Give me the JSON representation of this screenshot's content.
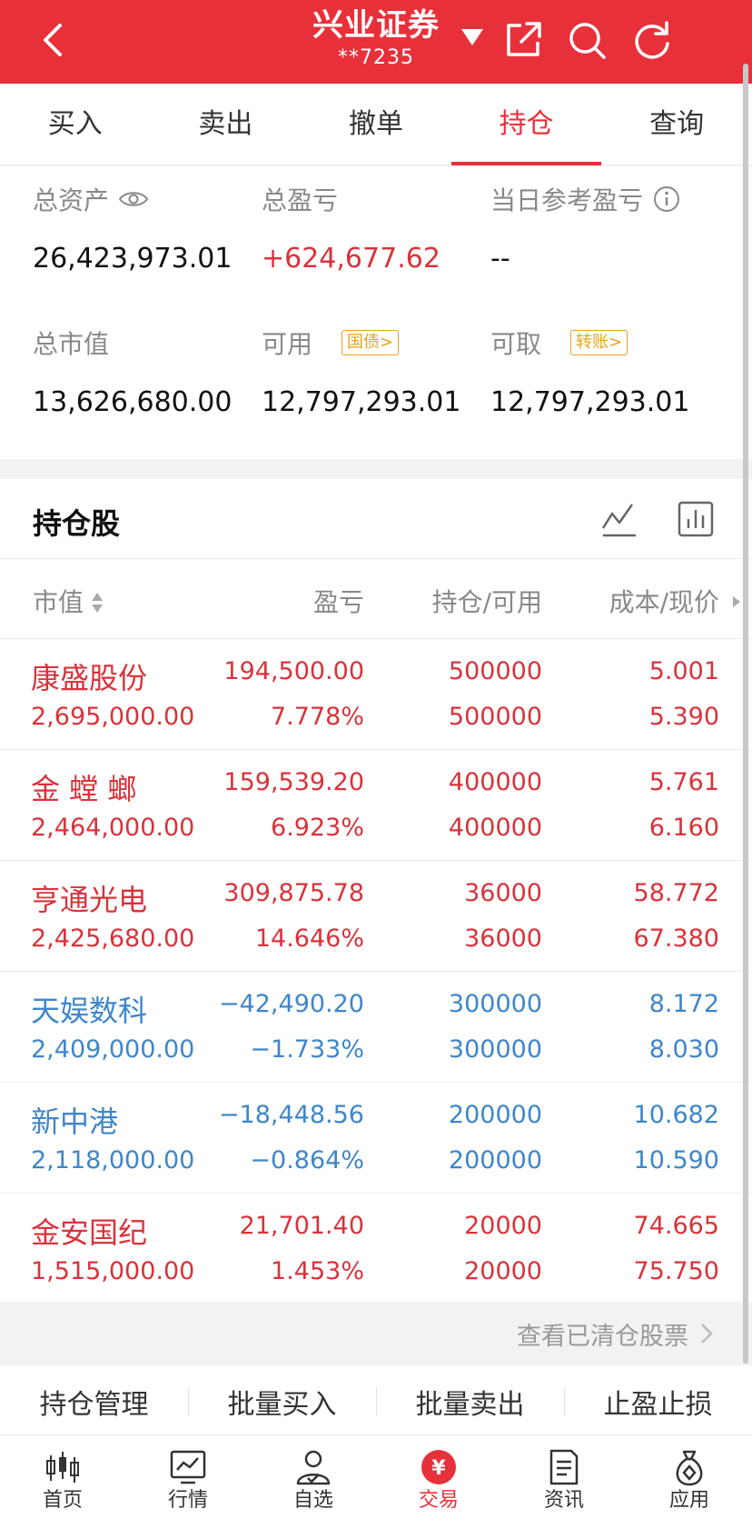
{
  "header": {
    "title": "兴业证券",
    "account": "**7235",
    "bg_color": "#e8303a"
  },
  "tabs": [
    {
      "label": "买入"
    },
    {
      "label": "卖出"
    },
    {
      "label": "撤单"
    },
    {
      "label": "持仓",
      "active": true
    },
    {
      "label": "查询"
    }
  ],
  "summary": {
    "total_assets_label": "总资产",
    "total_assets": "26,423,973.01",
    "total_pl_label": "总盈亏",
    "total_pl": "+624,677.62",
    "today_pl_label": "当日参考盈亏",
    "today_pl": "--",
    "market_value_label": "总市值",
    "market_value": "13,626,680.00",
    "available_label": "可用",
    "available_tag": "国债>",
    "available": "12,797,293.01",
    "withdrawable_label": "可取",
    "withdrawable_tag": "转账>",
    "withdrawable": "12,797,293.01"
  },
  "holdings": {
    "title": "持仓股",
    "columns": [
      "市值",
      "盈亏",
      "持仓/可用",
      "成本/现价"
    ],
    "rows": [
      {
        "name": "康盛股份",
        "market_value": "2,695,000.00",
        "pl": "194,500.00",
        "pl_pct": "7.778%",
        "position": "500000",
        "available": "500000",
        "cost": "5.001",
        "price": "5.390",
        "trend": "up"
      },
      {
        "name": "金 螳 螂",
        "market_value": "2,464,000.00",
        "pl": "159,539.20",
        "pl_pct": "6.923%",
        "position": "400000",
        "available": "400000",
        "cost": "5.761",
        "price": "6.160",
        "trend": "up"
      },
      {
        "name": "亨通光电",
        "market_value": "2,425,680.00",
        "pl": "309,875.78",
        "pl_pct": "14.646%",
        "position": "36000",
        "available": "36000",
        "cost": "58.772",
        "price": "67.380",
        "trend": "up"
      },
      {
        "name": "天娱数科",
        "market_value": "2,409,000.00",
        "pl": "−42,490.20",
        "pl_pct": "−1.733%",
        "position": "300000",
        "available": "300000",
        "cost": "8.172",
        "price": "8.030",
        "trend": "down"
      },
      {
        "name": "新中港",
        "market_value": "2,118,000.00",
        "pl": "−18,448.56",
        "pl_pct": "−0.864%",
        "position": "200000",
        "available": "200000",
        "cost": "10.682",
        "price": "10.590",
        "trend": "down"
      },
      {
        "name": "金安国纪",
        "market_value": "1,515,000.00",
        "pl": "21,701.40",
        "pl_pct": "1.453%",
        "position": "20000",
        "available": "20000",
        "cost": "74.665",
        "price": "75.750",
        "trend": "up"
      }
    ],
    "cleared_link": "查看已清仓股票"
  },
  "actions": [
    {
      "label": "持仓管理"
    },
    {
      "label": "批量买入"
    },
    {
      "label": "批量卖出"
    },
    {
      "label": "止盈止损"
    }
  ],
  "nav": [
    {
      "label": "首页",
      "icon": "candlestick-icon"
    },
    {
      "label": "行情",
      "icon": "chart-icon"
    },
    {
      "label": "自选",
      "icon": "user-check-icon"
    },
    {
      "label": "交易",
      "icon": "yuan-coin-icon",
      "active": true
    },
    {
      "label": "资讯",
      "icon": "document-icon"
    },
    {
      "label": "应用",
      "icon": "money-bag-icon"
    }
  ],
  "colors": {
    "accent": "#e8303a",
    "profit": "#d8333b",
    "loss": "#3f86c9",
    "tag": "#e8a21a"
  }
}
